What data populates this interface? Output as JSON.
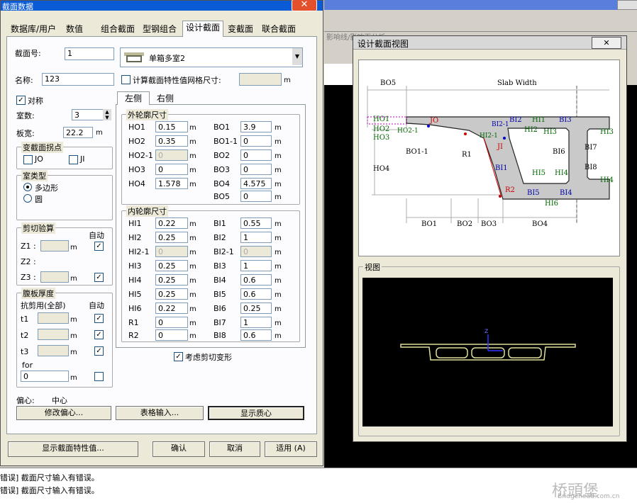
{
  "main_dialog": {
    "title": "截面数据",
    "tabs": [
      "数据库/用户",
      "数值",
      "组合截面",
      "型钢组合",
      "设计截面",
      "变截面",
      "联合截面"
    ],
    "section_no_label": "截面号:",
    "section_no": "1",
    "section_type": "单箱多室2",
    "name_label": "名称:",
    "name": "123",
    "mesh_label": "计算截面特性值网格尺寸:",
    "mesh_unit": "m",
    "symmetric_label": "对称",
    "cells_label": "室数:",
    "cells": "3",
    "width_label": "板宽:",
    "width": "22.2",
    "width_unit": "m",
    "vary_group": "变截面拐点",
    "jo": "JO",
    "ji": "JI",
    "room_type_group": "室类型",
    "polygon": "多边形",
    "circle": "圆",
    "shear_group": "剪切验算",
    "auto": "自动",
    "z1": "Z1 :",
    "z2": "Z2 :",
    "z3": "Z3 :",
    "web_group": "腹板厚度",
    "shear_all": "抗剪用(全部)",
    "t1": "t1",
    "t2": "t2",
    "t3": "t3",
    "tor": "for",
    "tor_value": "0",
    "offset_label": "偏心:",
    "offset_value": "中心",
    "btn_modify_offset": "修改偏心...",
    "btn_table_input": "表格输入...",
    "btn_show_centroid": "显示质心",
    "side_left": "左侧",
    "side_right": "右侧",
    "outer_group": "外轮廓尺寸",
    "inner_group": "内轮廓尺寸",
    "outer_left": [
      {
        "label": "HO1",
        "value": "0.15"
      },
      {
        "label": "HO2",
        "value": "0.35"
      },
      {
        "label": "HO2-1",
        "value": "0"
      },
      {
        "label": "HO3",
        "value": "0"
      },
      {
        "label": "HO4",
        "value": "1.578"
      }
    ],
    "outer_right": [
      {
        "label": "BO1",
        "value": "3.9"
      },
      {
        "label": "BO1-1",
        "value": "0"
      },
      {
        "label": "BO2",
        "value": "0"
      },
      {
        "label": "BO3",
        "value": "0"
      },
      {
        "label": "BO4",
        "value": "4.575"
      },
      {
        "label": "BO5",
        "value": "0"
      }
    ],
    "inner_left": [
      {
        "label": "HI1",
        "value": "0.22"
      },
      {
        "label": "HI2",
        "value": "0.25"
      },
      {
        "label": "HI2-1",
        "value": "0"
      },
      {
        "label": "HI3",
        "value": "0.25"
      },
      {
        "label": "HI4",
        "value": "0.25"
      },
      {
        "label": "HI5",
        "value": "0.25"
      },
      {
        "label": "HI6",
        "value": "0.22"
      },
      {
        "label": "R1",
        "value": "0"
      },
      {
        "label": "R2",
        "value": "0"
      }
    ],
    "inner_right": [
      {
        "label": "BI1",
        "value": "0.55"
      },
      {
        "label": "BI2",
        "value": "1"
      },
      {
        "label": "BI2-1",
        "value": "0"
      },
      {
        "label": "BI3",
        "value": "1"
      },
      {
        "label": "BI4",
        "value": "0.6"
      },
      {
        "label": "BI5",
        "value": "0.6"
      },
      {
        "label": "BI6",
        "value": "0.25"
      },
      {
        "label": "BI7",
        "value": "1"
      },
      {
        "label": "BI8",
        "value": "0.6"
      }
    ],
    "unit": "m",
    "shear_deform": "考虑剪切变形",
    "btn_show_props": "显示截面特性值...",
    "btn_ok": "确认",
    "btn_cancel": "取消",
    "btn_apply": "适用 (A)"
  },
  "view_dialog": {
    "title": "设计截面视图",
    "view_label": "视图",
    "slab_width": "Slab Width",
    "background_hint": "影响线/影响面分析"
  },
  "diagram_labels": {
    "BO5": "BO5",
    "HO1": "HO1",
    "HO2": "HO2",
    "HO3": "HO3",
    "HO4": "HO4",
    "HO2-1": "HO2-1",
    "BO1-1": "BO1-1",
    "JO": "JO",
    "JI": "JI",
    "R1": "R1",
    "R2": "R2",
    "HI2-1": "HI2-1",
    "BI2-1": "BI2-1",
    "BI2": "BI2",
    "HI1": "HI1",
    "BI3": "BI3",
    "HI2": "HI2",
    "HI3": "HI3",
    "HI3r": "HI3",
    "BI6": "BI6",
    "BI7": "BI7",
    "BI1": "BI1",
    "HI5": "HI5",
    "HI4": "HI4",
    "HI4r": "HI4",
    "BI8": "BI8",
    "BI5": "BI5",
    "BI4": "BI4",
    "HI6": "HI6",
    "BO1": "BO1",
    "BO2": "BO2",
    "BO3": "BO3",
    "BO4": "BO4"
  },
  "axis": {
    "z": "z"
  },
  "status": {
    "line1": "错误] 截面尺寸输入有错误。",
    "line2": "错误] 截面尺寸输入有错误。",
    "watermark": "桥頭堡",
    "watermark_url": "Bridgehead.com.cn"
  },
  "colors": {
    "title_blue": "#0b5bd7",
    "canvas": "#000000",
    "section_fill": "#c9c9c9"
  }
}
